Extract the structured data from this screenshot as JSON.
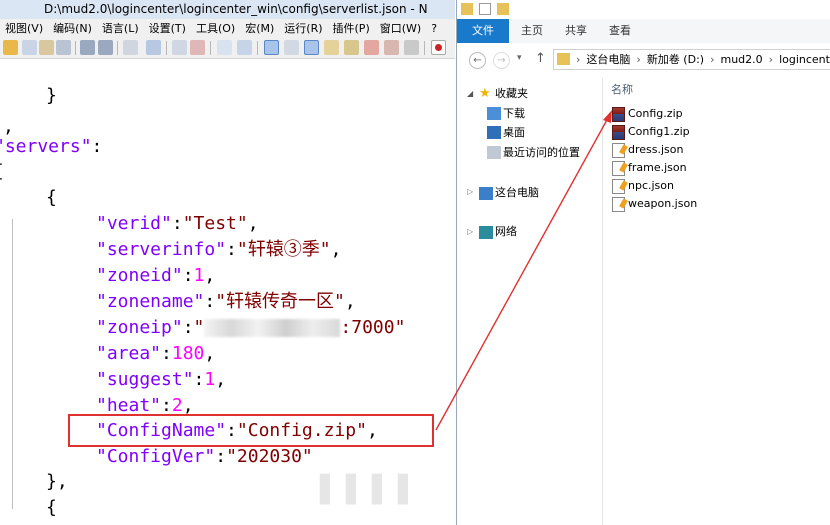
{
  "editor": {
    "title": "D:\\mud2.0\\logincenter\\logincenter_win\\config\\serverlist.json - N",
    "menu": [
      "视图(V)",
      "编码(N)",
      "语言(L)",
      "设置(T)",
      "工具(O)",
      "宏(M)",
      "运行(R)",
      "插件(P)",
      "窗口(W)",
      "?"
    ],
    "lines": {
      "brace_close": "}",
      "comma": ",",
      "servers_key": "\"servers\"",
      "colon": ":",
      "bracket_open": "[",
      "obj_open": "{",
      "verid_key": "\"verid\"",
      "verid_val": "\"Test\"",
      "serverinfo_key": "\"serverinfo\"",
      "serverinfo_val": "\"轩辕③季\"",
      "zoneid_key": "\"zoneid\"",
      "zoneid_val": "1",
      "zonename_key": "\"zonename\"",
      "zonename_val": "\"轩辕传奇一区\"",
      "zoneip_key": "\"zoneip\"",
      "zoneip_prefix": "\"",
      "zoneip_suffix": ":7000\"",
      "area_key": "\"area\"",
      "area_val": "180",
      "suggest_key": "\"suggest\"",
      "suggest_val": "1",
      "heat_key": "\"heat\"",
      "heat_val": "2",
      "configname_key": "\"ConfigName\"",
      "configname_val": "\"Config.zip\"",
      "configver_key": "\"ConfigVer\"",
      "configver_val": "\"202030\"",
      "obj_close": "},",
      "obj_open2": "{"
    }
  },
  "explorer": {
    "ribbon_tabs": [
      "文件",
      "主页",
      "共享",
      "查看"
    ],
    "breadcrumb": [
      "这台电脑",
      "新加卷 (D:)",
      "mud2.0",
      "logincenter"
    ],
    "nav": {
      "favorites": "收藏夹",
      "downloads": "下载",
      "desktop": "桌面",
      "recent": "最近访问的位置",
      "this_pc": "这台电脑",
      "network": "网络"
    },
    "column_name": "名称",
    "files": [
      "Config.zip",
      "Config1.zip",
      "dress.json",
      "frame.json",
      "npc.json",
      "weapon.json"
    ]
  },
  "colors": {
    "keyword": "#8000ff",
    "string": "#800000",
    "number": "#ff00ff",
    "highlight": "#e03030",
    "ribbon_file_tab": "#1979ca"
  }
}
